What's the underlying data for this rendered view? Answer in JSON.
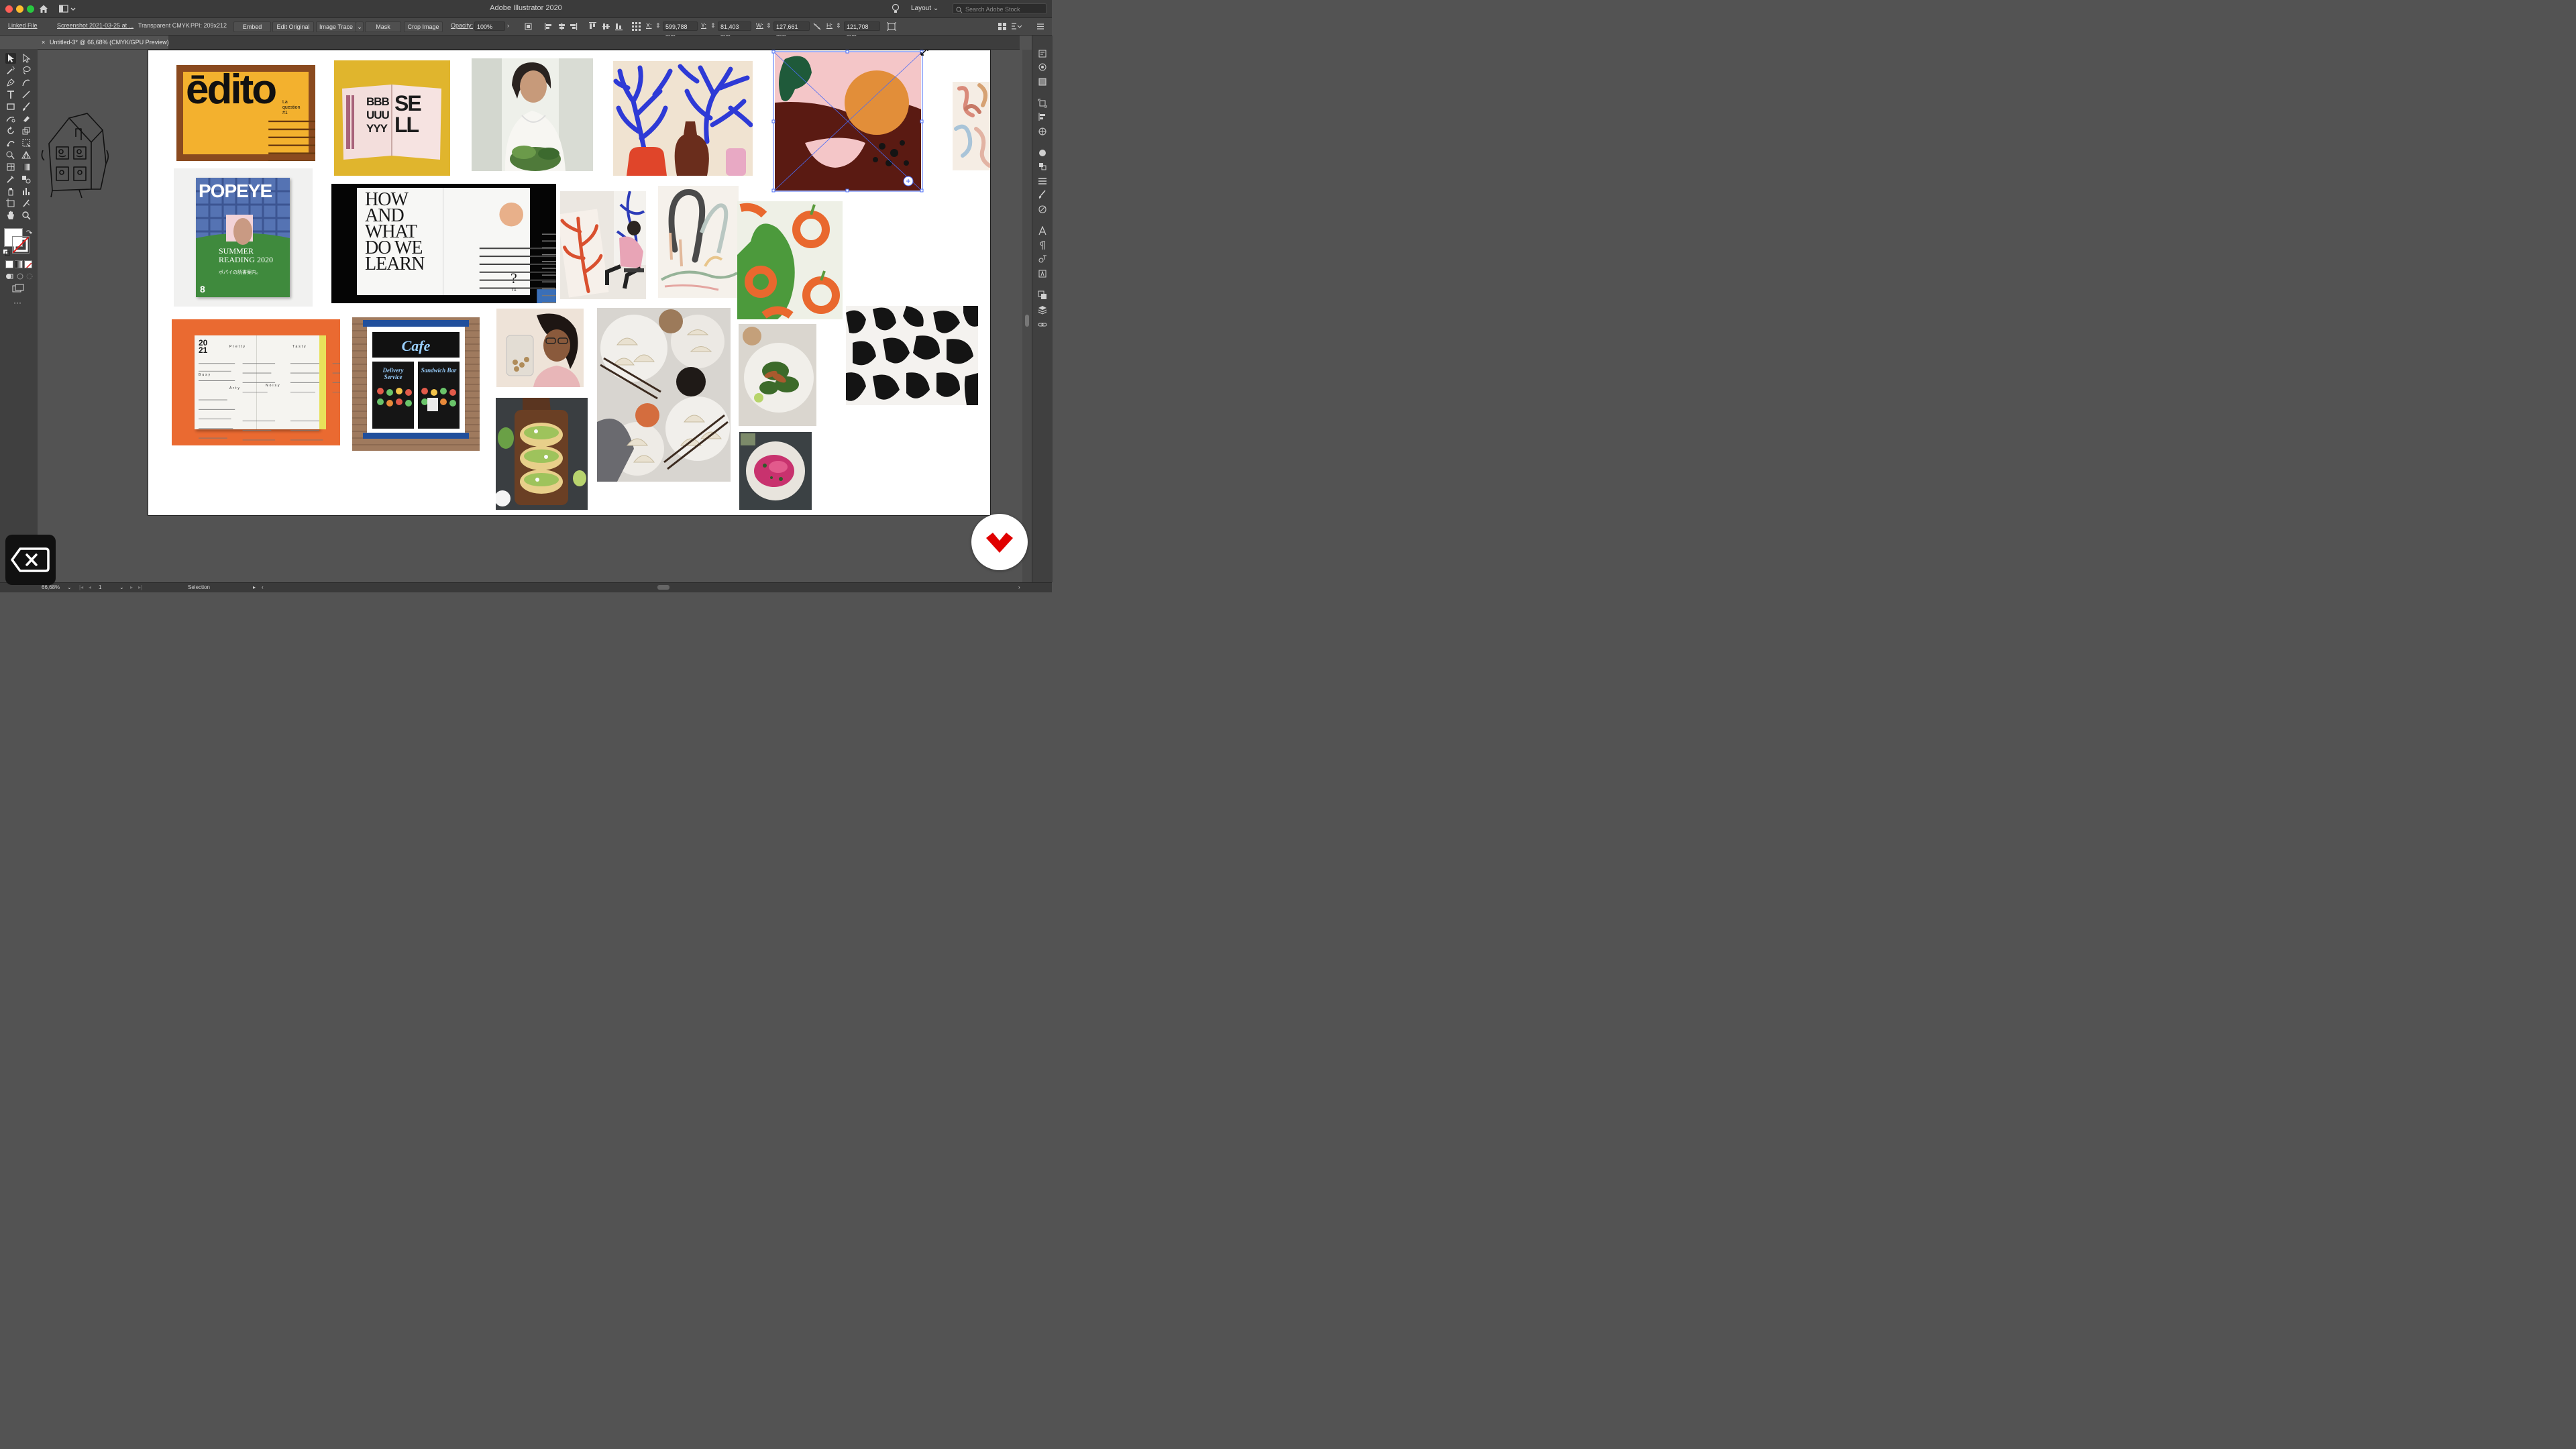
{
  "window": {
    "title": "Adobe Illustrator 2020"
  },
  "header": {
    "layout_label": "Layout",
    "search_placeholder": "Search Adobe Stock"
  },
  "control_bar": {
    "linked_file": "Linked File",
    "file_name": "Screenshot 2021-03-25 at ...",
    "color_mode": "Transparent CMYK",
    "ppi": "PPI: 209x212",
    "embed": "Embed",
    "edit_original": "Edit Original",
    "image_trace": "Image Trace",
    "mask": "Mask",
    "crop_image": "Crop Image",
    "opacity_label": "Opacity:",
    "opacity_value": "100%",
    "x_label": "X:",
    "x_value": "599,788 mm",
    "y_label": "Y:",
    "y_value": "81,403 mm",
    "w_label": "W:",
    "w_value": "127,661 mm",
    "h_label": "H:",
    "h_value": "121,708 mm"
  },
  "document_tab": {
    "title": "Untitled-3* @ 66,68% (CMYK/GPU Preview)"
  },
  "artboard": {
    "editorial_cover": {
      "title": "ēdito",
      "subtitle": "La question #1"
    },
    "book_spread": {
      "left": "BBB UUU YYY",
      "right": "SE LL"
    },
    "popeye_cover": {
      "masthead": "POPEYE",
      "headline": "SUMMER READING 2020",
      "japanese": "ポパイの読書案内。",
      "issue": "8"
    },
    "how_spread": {
      "headline": "HOW AND WHAT DO WE LEARN",
      "question": "?",
      "page": "71"
    },
    "toc_spread": {
      "year": "20 21",
      "col1": "Pretty",
      "col2": "Tasty",
      "col3": "Busy",
      "col4": "Arty",
      "col5": "Noisy"
    },
    "cafe_window": {
      "sign": "Cafe",
      "left_sign": "Delivery Service",
      "right_sign": "Sandwich Bar"
    }
  },
  "status_bar": {
    "zoom": "66,68%",
    "page": "1",
    "tool": "Selection"
  },
  "colors": {
    "selection": "#4a6cf7",
    "brand_red": "#e00000"
  }
}
